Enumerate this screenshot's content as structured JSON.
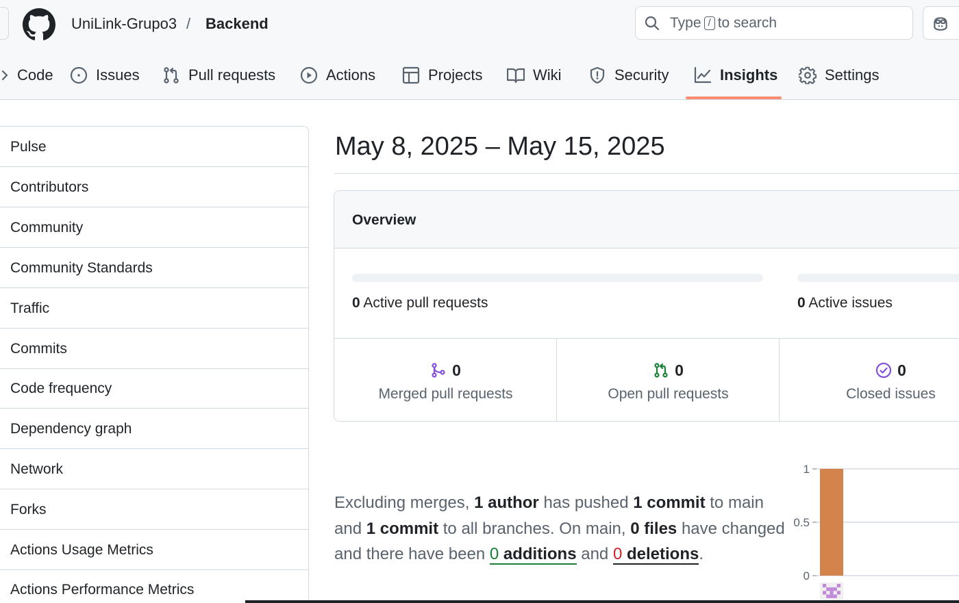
{
  "header": {
    "owner": "UniLink-Grupo3",
    "separator": "/",
    "repo": "Backend",
    "search": {
      "prefix": "Type",
      "key": "/",
      "suffix": "to search"
    }
  },
  "tabs": [
    {
      "label": "Code",
      "icon": "code-icon"
    },
    {
      "label": "Issues",
      "icon": "issue-opened-icon"
    },
    {
      "label": "Pull requests",
      "icon": "git-pull-request-icon"
    },
    {
      "label": "Actions",
      "icon": "play-icon"
    },
    {
      "label": "Projects",
      "icon": "table-icon"
    },
    {
      "label": "Wiki",
      "icon": "book-icon"
    },
    {
      "label": "Security",
      "icon": "shield-icon"
    },
    {
      "label": "Insights",
      "icon": "graph-icon",
      "selected": true
    },
    {
      "label": "Settings",
      "icon": "gear-icon"
    }
  ],
  "sidebar": {
    "items": [
      "Pulse",
      "Contributors",
      "Community",
      "Community Standards",
      "Traffic",
      "Commits",
      "Code frequency",
      "Dependency graph",
      "Network",
      "Forks",
      "Actions Usage Metrics",
      "Actions Performance Metrics"
    ]
  },
  "main": {
    "title": "May 8, 2025 – May 15, 2025",
    "overview": {
      "heading": "Overview",
      "active_prs": {
        "count": "0",
        "label": "Active pull requests"
      },
      "active_issues": {
        "count": "0",
        "label": "Active issues"
      },
      "merged_prs": {
        "count": "0",
        "label": "Merged pull requests"
      },
      "open_prs": {
        "count": "0",
        "label": "Open pull requests"
      },
      "closed_issues": {
        "count": "0",
        "label": "Closed issues"
      }
    },
    "summary": {
      "t1": "Excluding merges, ",
      "authors": "1 author",
      "t2": " has pushed ",
      "commits_main": "1 commit",
      "t3": " to main and ",
      "commits_all": "1 commit",
      "t4": " to all branches. On main, ",
      "files": "0 files",
      "t5": " have changed and there have been ",
      "additions_num": "0",
      "additions_word": " additions",
      "t6": " and ",
      "deletions_num": "0",
      "deletions_word": " deletions",
      "t7": "."
    }
  },
  "chart_data": {
    "type": "bar",
    "categories": [
      "author"
    ],
    "values": [
      1
    ],
    "yticks": [
      "1",
      "0.5",
      "0"
    ],
    "ylim": [
      0,
      1
    ],
    "bar_color": "#d4834a"
  },
  "colors": {
    "merged": "#8250df",
    "open": "#1a7f37",
    "closed": "#8250df",
    "tab_underline": "#fd8c73"
  }
}
